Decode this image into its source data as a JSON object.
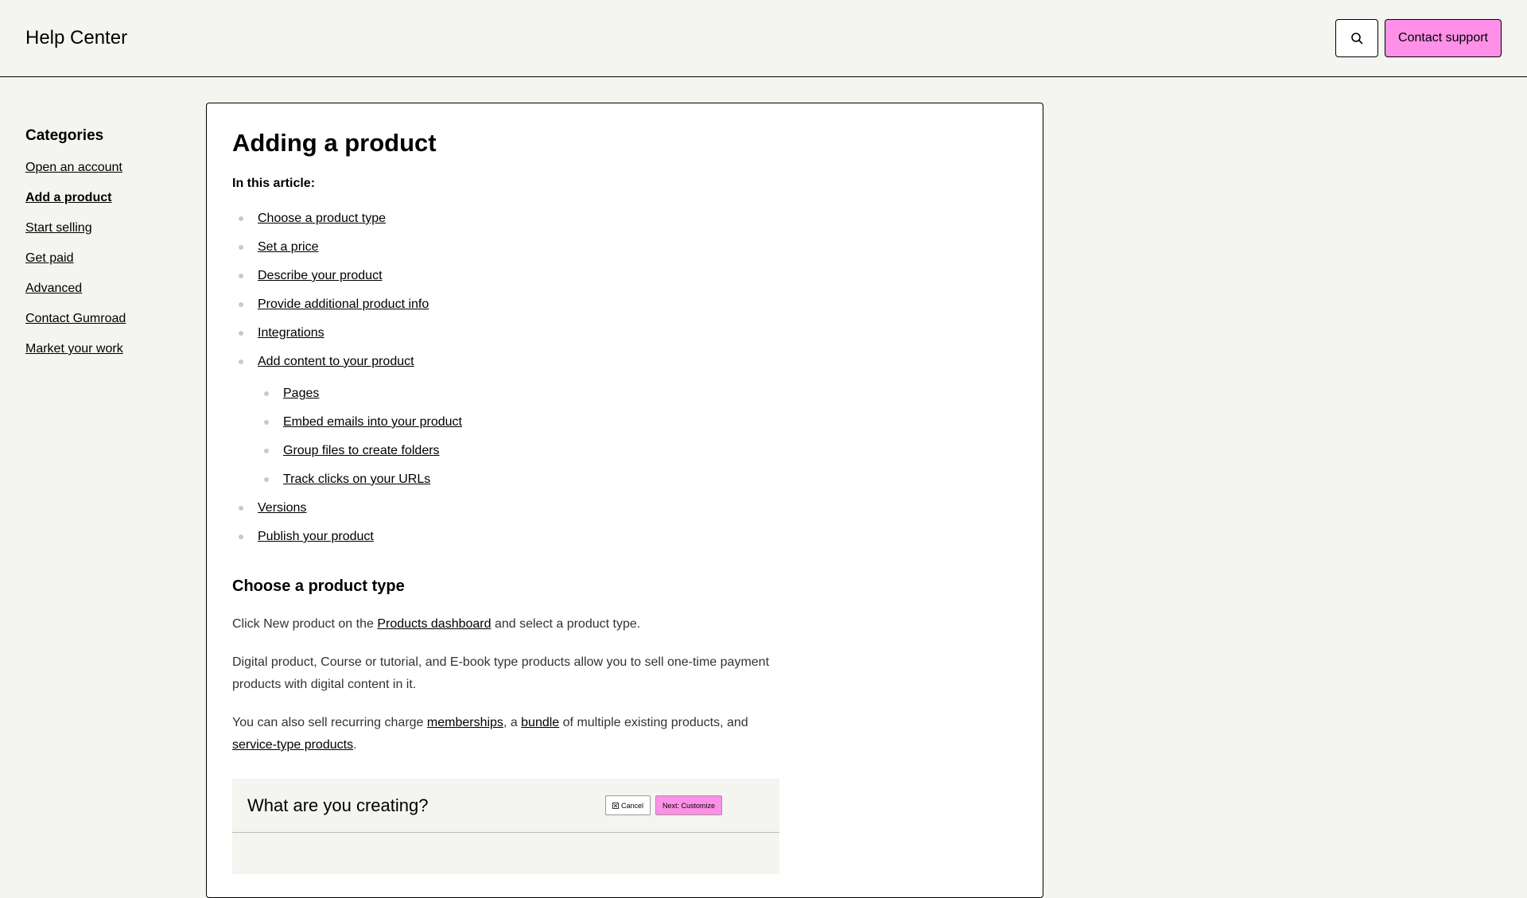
{
  "header": {
    "title": "Help Center",
    "search_icon": "search-icon",
    "support_label": "Contact support"
  },
  "sidebar": {
    "heading": "Categories",
    "items": [
      {
        "label": "Open an account",
        "active": false
      },
      {
        "label": "Add a product",
        "active": true
      },
      {
        "label": "Start selling",
        "active": false
      },
      {
        "label": "Get paid",
        "active": false
      },
      {
        "label": "Advanced",
        "active": false
      },
      {
        "label": "Contact Gumroad",
        "active": false
      },
      {
        "label": "Market your work",
        "active": false
      }
    ]
  },
  "article": {
    "title": "Adding a product",
    "toc_label": "In this article:",
    "toc": [
      "Choose a product type",
      "Set a price",
      "Describe your product",
      "Provide additional product info",
      "Integrations",
      "Add content to your product",
      "Versions",
      "Publish your product"
    ],
    "toc_sub": [
      "Pages",
      "Embed emails into your product",
      "Group files to create folders",
      "Track clicks on your URLs"
    ],
    "section_heading": "Choose a product type",
    "p1_before": "Click New product on the ",
    "p1_link": "Products dashboard",
    "p1_after": " and select a product type.",
    "p2": "Digital product, Course or tutorial, and E-book type products allow you to sell one-time payment products with digital content in it.",
    "p3_a": "You can also sell recurring charge ",
    "p3_link1": "memberships",
    "p3_b": ", a ",
    "p3_link2": "bundle",
    "p3_c": " of multiple existing products, and ",
    "p3_link3": "service-type products",
    "p3_d": ".",
    "preview": {
      "title": "What are you creating?",
      "cancel_label": "Cancel",
      "next_label": "Next: Customize"
    }
  },
  "colors": {
    "accent": "#ff90e8",
    "background": "#f4f4f0"
  }
}
